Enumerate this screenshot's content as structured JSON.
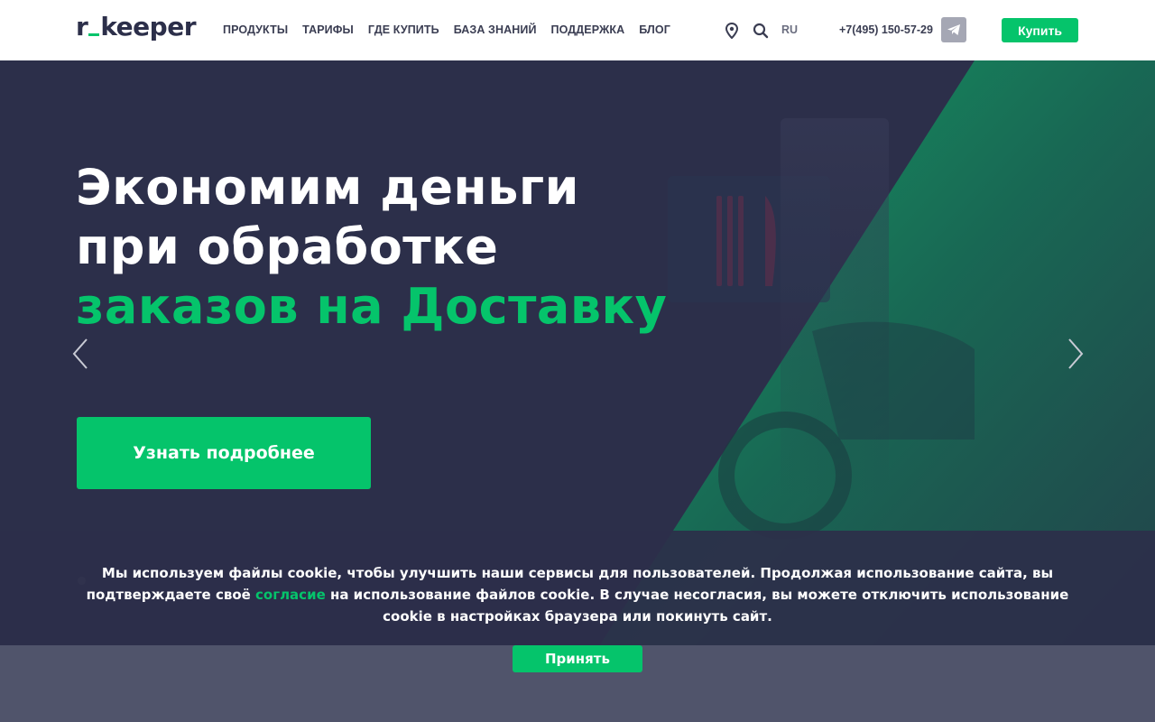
{
  "header": {
    "logo_left": "r",
    "logo_right": "keeper",
    "nav": [
      "ПРОДУКТЫ",
      "ТАРИФЫ",
      "ГДЕ КУПИТЬ",
      "БАЗА ЗНАНИЙ",
      "ПОДДЕРЖКА",
      "БЛОГ"
    ],
    "lang": "RU",
    "phone": "+7(495) 150-57-29",
    "buy_label": "Купить",
    "icons": {
      "location": "map-pin-icon",
      "search": "search-icon",
      "telegram": "telegram-icon"
    }
  },
  "hero": {
    "title_line1": "Экономим деньги",
    "title_line2": "при обработке",
    "title_line3": "заказов на Доставку",
    "cta_label": "Узнать подробнее",
    "slides_count": 3,
    "active_slide": 1
  },
  "cookie": {
    "text_before": "Мы используем файлы cookie, чтобы улучшить наши сервисы для пользователей. Продолжая использование сайта, вы подтверждаете своё ",
    "link_text": "согласие",
    "text_after": " на использование файлов cookie. В случае несогласия, вы можете отключить использование cookie в настройках браузера или покинуть сайт.",
    "accept_label": "Принять"
  },
  "colors": {
    "accent": "#05c46b",
    "hero_bg": "#2c2f4a",
    "header_bg": "#ffffff"
  }
}
